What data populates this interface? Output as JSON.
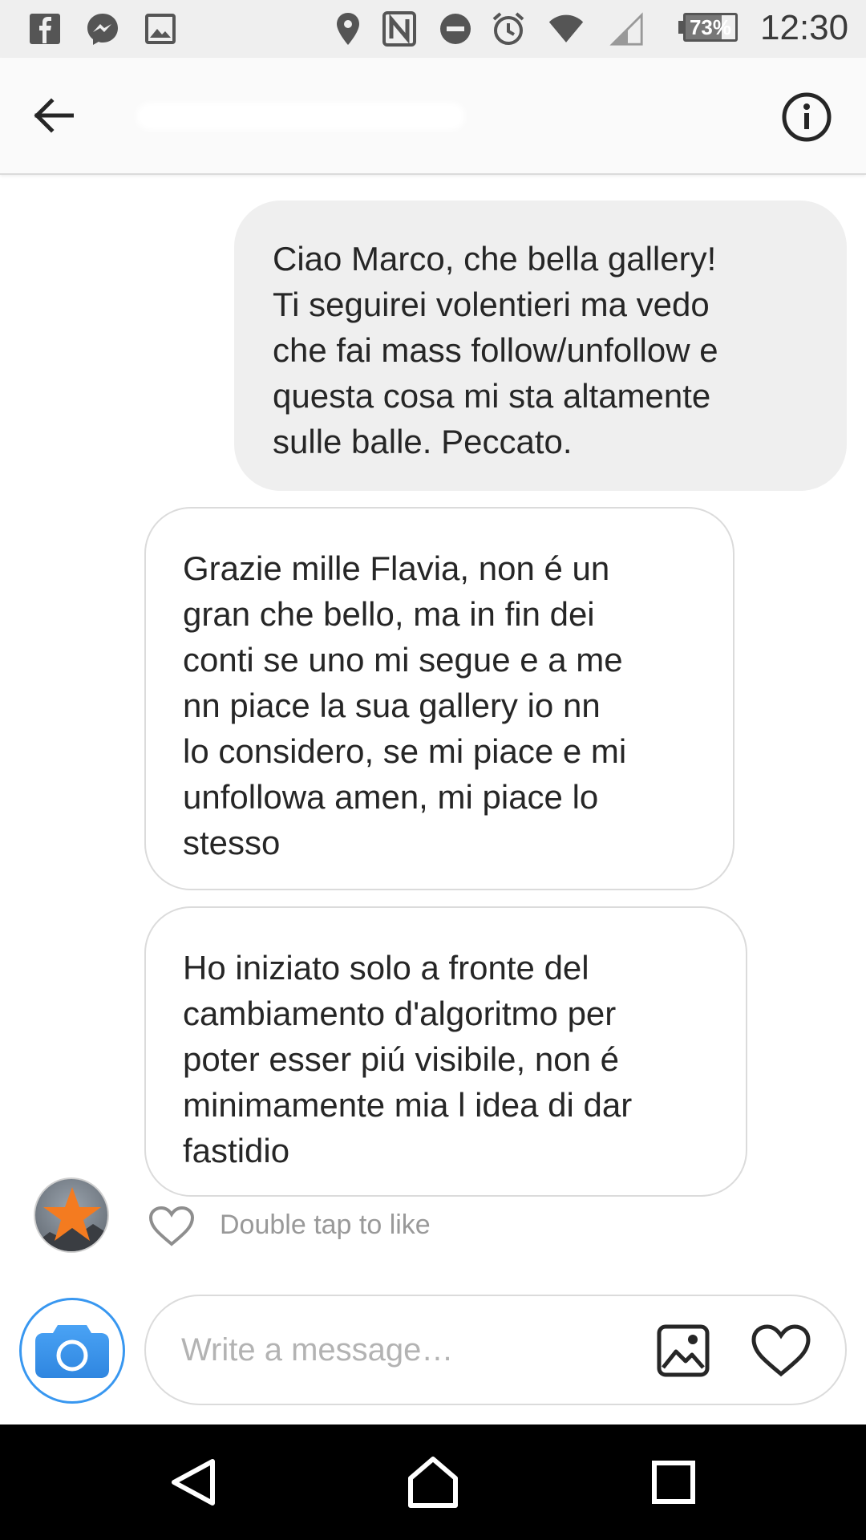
{
  "status_bar": {
    "icons": [
      "facebook-icon",
      "messenger-icon",
      "image-notification-icon",
      "location-icon",
      "nfc-icon",
      "do-not-disturb-icon",
      "alarm-icon",
      "wifi-icon",
      "cell-signal-icon"
    ],
    "battery_level": 0.73,
    "battery_label": "73%",
    "time": "12:30"
  },
  "header": {
    "back_icon": "arrow-left-icon",
    "info_icon": "info-icon"
  },
  "messages": [
    {
      "direction": "sent",
      "text": "Ciao Marco, che bella gallery!\nTi seguirei volentieri ma vedo\nche fai mass follow/unfollow e\nquesta cosa mi sta altamente\nsulle balle. Peccato."
    },
    {
      "direction": "received",
      "text": "Grazie mille Flavia, non é un\ngran che bello, ma in fin dei\nconti se uno mi segue e a me\nnn piace la sua gallery io nn\nlo considero, se mi piace e mi\nunfollowa amen, mi piace lo\nstesso"
    },
    {
      "direction": "received",
      "text": "Ho iniziato solo a fronte del\ncambiamento d'algoritmo per\npoter esser piú visibile, non é\nminimamente mia l idea di dar\nfastidio"
    }
  ],
  "like_row": {
    "heart_icon": "heart-outline-icon",
    "label": "Double tap to like"
  },
  "composer": {
    "camera_icon": "camera-icon",
    "placeholder": "Write a message…",
    "gallery_icon": "gallery-icon",
    "heart_icon": "heart-outline-icon"
  },
  "nav_bar": {
    "icons": [
      "nav-back-icon",
      "nav-home-icon",
      "nav-recents-icon"
    ]
  },
  "colors": {
    "accent_blue": "#3897f0",
    "sent_bubble": "#efefef",
    "bubble_border": "#dbdbdb",
    "avatar_star": "#f47b20"
  }
}
